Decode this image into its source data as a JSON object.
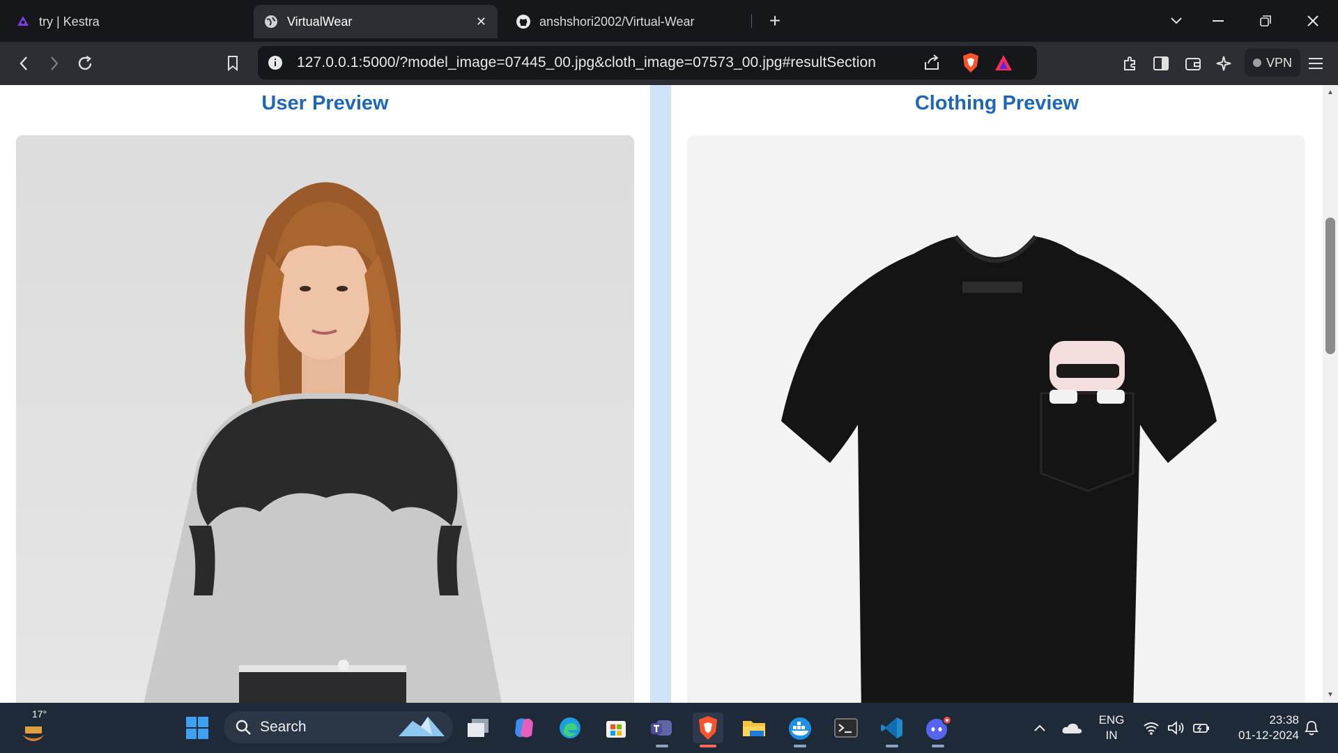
{
  "tabs": [
    {
      "title": "try | Kestra",
      "active": false,
      "icon": "kestra-icon"
    },
    {
      "title": "VirtualWear",
      "active": true,
      "icon": "globe-icon"
    },
    {
      "title": "anshshori2002/Virtual-Wear",
      "active": false,
      "icon": "github-icon"
    }
  ],
  "toolbar": {
    "url": "127.0.0.1:5000/?model_image=07445_00.jpg&cloth_image=07573_00.jpg#resultSection",
    "vpn_label": "VPN"
  },
  "page": {
    "user_title": "User Preview",
    "cloth_title": "Clothing Preview",
    "accent": "#1d67b8"
  },
  "taskbar": {
    "weather_temp": "17°",
    "search_placeholder": "Search",
    "lang_top": "ENG",
    "lang_bottom": "IN",
    "time": "23:38",
    "date": "01-12-2024"
  }
}
